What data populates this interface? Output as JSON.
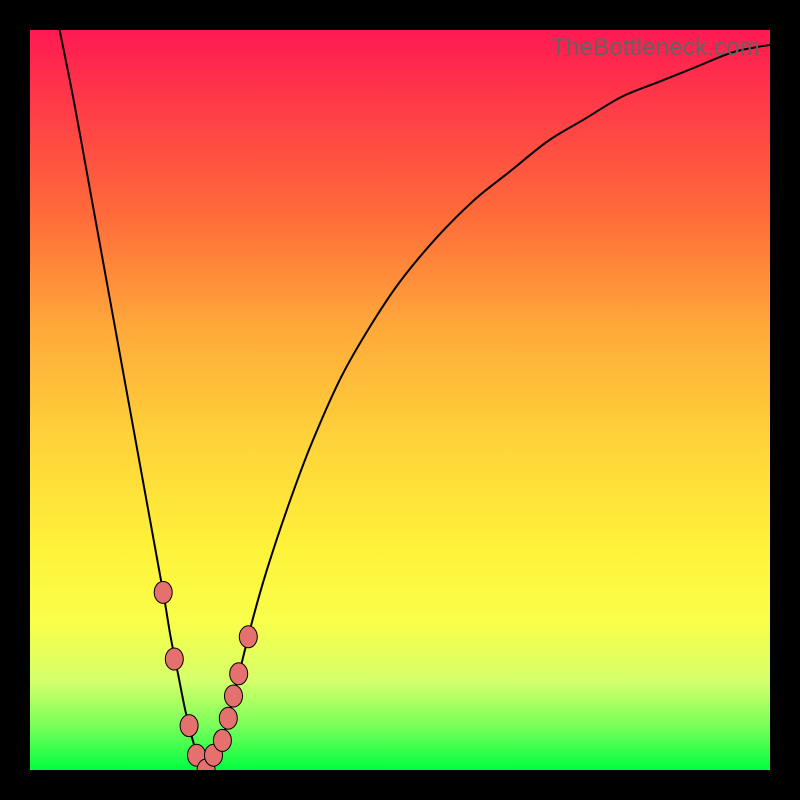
{
  "watermark": "TheBottleneck.com",
  "chart_data": {
    "type": "line",
    "title": "",
    "xlabel": "",
    "ylabel": "",
    "xlim": [
      0,
      100
    ],
    "ylim": [
      0,
      100
    ],
    "series": [
      {
        "name": "bottleneck-curve",
        "x": [
          4,
          6,
          8,
          10,
          12,
          14,
          16,
          18,
          19,
          20,
          21,
          22,
          23,
          24,
          25,
          26,
          28,
          30,
          32,
          35,
          38,
          42,
          46,
          50,
          55,
          60,
          65,
          70,
          75,
          80,
          85,
          90,
          95,
          100
        ],
        "values": [
          100,
          90,
          79,
          68,
          57,
          46,
          35,
          24,
          18,
          13,
          8,
          4,
          1,
          0,
          1,
          4,
          12,
          20,
          27,
          36,
          44,
          53,
          60,
          66,
          72,
          77,
          81,
          85,
          88,
          91,
          93,
          95,
          97,
          98
        ]
      }
    ],
    "markers": {
      "name": "highlighted-points",
      "x": [
        18.0,
        19.5,
        21.5,
        22.5,
        23.8,
        24.8,
        26.0,
        26.8,
        27.5,
        28.2,
        29.5
      ],
      "values": [
        24,
        15,
        6,
        2,
        0,
        2,
        4,
        7,
        10,
        13,
        18
      ]
    },
    "legend": false,
    "grid": false,
    "background": {
      "type": "vertical-gradient",
      "stops": [
        {
          "pos": 0.0,
          "color": "#ff1a52"
        },
        {
          "pos": 0.25,
          "color": "#ff6b3a"
        },
        {
          "pos": 0.55,
          "color": "#ffd23a"
        },
        {
          "pos": 0.8,
          "color": "#f9ff4a"
        },
        {
          "pos": 1.0,
          "color": "#00ff40"
        }
      ]
    }
  }
}
